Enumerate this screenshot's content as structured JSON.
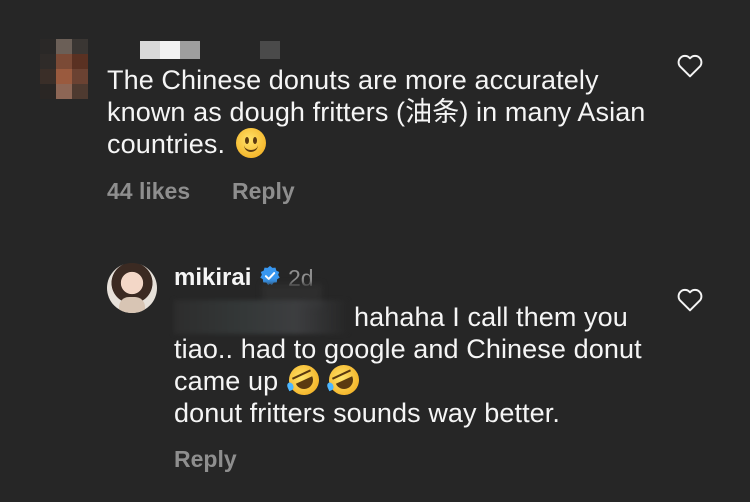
{
  "comment1": {
    "text": "The Chinese donuts are more accurately known as dough fritters (油条) in many Asian countries.",
    "emoji": "slightly-smiling-face",
    "likes": "44 likes",
    "reply_label": "Reply"
  },
  "comment2": {
    "username": "mikirai",
    "verified": true,
    "time": "2d",
    "text": "hahaha I call them you tiao.. had to google and Chinese donut came up",
    "text_end": "donut fritters sounds way better.",
    "emoji": "rolling-on-floor-laughing",
    "reply_label": "Reply"
  },
  "colors": {
    "background": "#262626",
    "text": "#f5f5f5",
    "muted": "#8e8e8e",
    "verified": "#3897f0"
  },
  "icons": [
    "heart-outline-icon",
    "verified-badge-icon"
  ]
}
